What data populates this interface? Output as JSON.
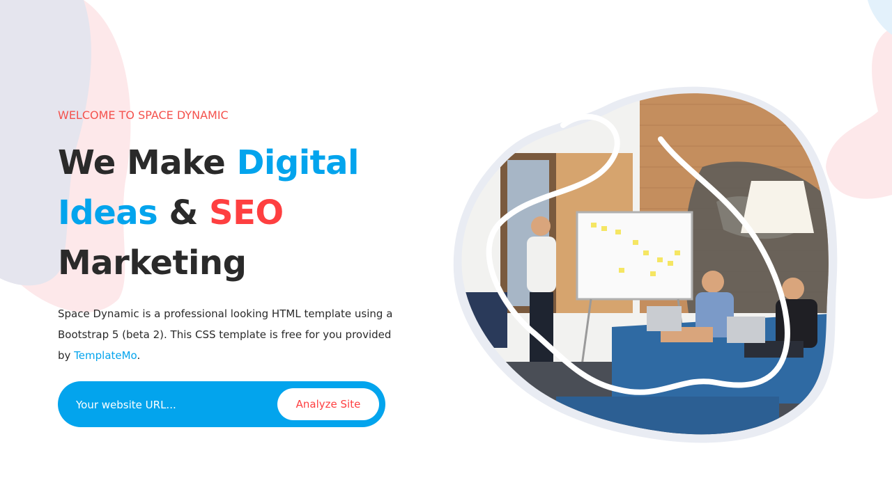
{
  "hero": {
    "eyebrow": "WELCOME TO SPACE DYNAMIC",
    "headline": {
      "part1": "We Make ",
      "part2": "Digital",
      "part3": "Ideas",
      "part4": " & ",
      "part5": "SEO",
      "part6": "Marketing"
    },
    "description": {
      "text": "Space Dynamic is a professional looking HTML template using a Bootstrap 5 (beta 2). This CSS template is free for you provided by ",
      "link": "TemplateMo",
      "end": "."
    }
  },
  "search": {
    "placeholder": "Your website URL...",
    "button_label": "Analyze Site"
  },
  "colors": {
    "accent_blue": "#03a4ed",
    "accent_red": "#fe3f40",
    "text_dark": "#2a2a2a"
  }
}
